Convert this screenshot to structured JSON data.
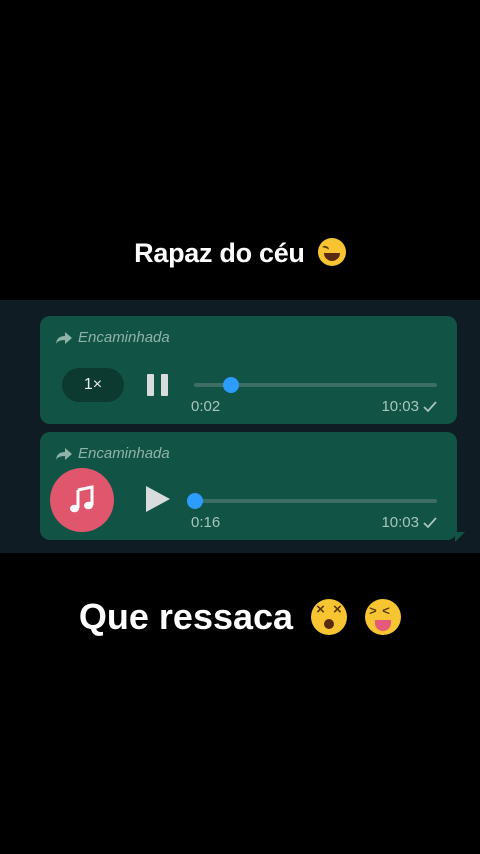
{
  "captions": {
    "top": "Rapaz do céu",
    "bottom": "Que ressaca"
  },
  "messages": [
    {
      "forwarded_label": "Encaminhada",
      "speed_label": "1×",
      "state": "playing",
      "progress": 0.15,
      "duration": "0:02",
      "time": "10:03"
    },
    {
      "forwarded_label": "Encaminhada",
      "state": "paused",
      "progress": 0.0,
      "duration": "0:16",
      "time": "10:03",
      "avatar_icon": "music-note-icon"
    }
  ],
  "colors": {
    "bubble": "#115445",
    "chat_background": "#0f1c24",
    "progress_knob": "#2d9cff",
    "avatar": "#e0566d"
  },
  "emojis": {
    "top": "tears-of-joy-emoji",
    "bottom": [
      "dizzy-face-emoji",
      "squinting-tongue-emoji"
    ]
  }
}
